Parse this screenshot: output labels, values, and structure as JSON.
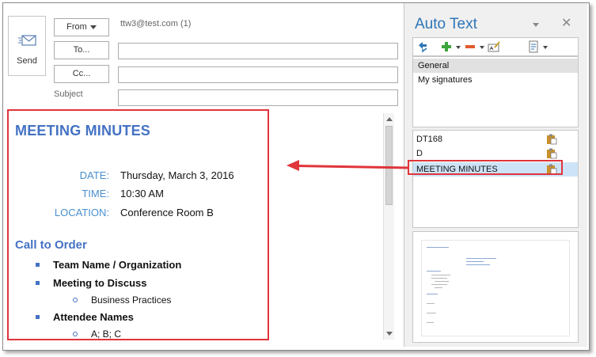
{
  "compose": {
    "send_label": "Send",
    "from_label": "From",
    "from_address": "ttw3@test.com (1)",
    "to_label": "To...",
    "cc_label": "Cc...",
    "subject_label": "Subject"
  },
  "message": {
    "title": "MEETING MINUTES",
    "rows": [
      {
        "label": "DATE:",
        "value": "Thursday, March 3, 2016"
      },
      {
        "label": "TIME:",
        "value": "10:30 AM"
      },
      {
        "label": "LOCATION:",
        "value": "Conference Room B"
      }
    ],
    "section_heading": "Call to Order",
    "bullets": [
      {
        "text": "Team Name / Organization"
      },
      {
        "text": "Meeting to Discuss",
        "sub": "Business Practices"
      },
      {
        "text": "Attendee Names",
        "sub": "A; B; C"
      }
    ]
  },
  "autotext_pane": {
    "title": "Auto Text",
    "close_glyph": "✕",
    "categories": [
      "General",
      "My signatures"
    ],
    "selected_category": "General",
    "entries": [
      "DT168",
      "D",
      "MEETING MINUTES"
    ],
    "selected_entry": "MEETING MINUTES"
  },
  "icons": {
    "refresh": "refresh-icon",
    "add": "add-icon",
    "remove": "remove-icon",
    "rename": "rename-icon",
    "properties": "properties-icon",
    "clipboard": "clipboard-icon"
  },
  "colors": {
    "accent_blue": "#4472c4",
    "label_blue": "#4a8fcf",
    "highlight_red": "#e0353b",
    "selection": "#cde3f7"
  }
}
